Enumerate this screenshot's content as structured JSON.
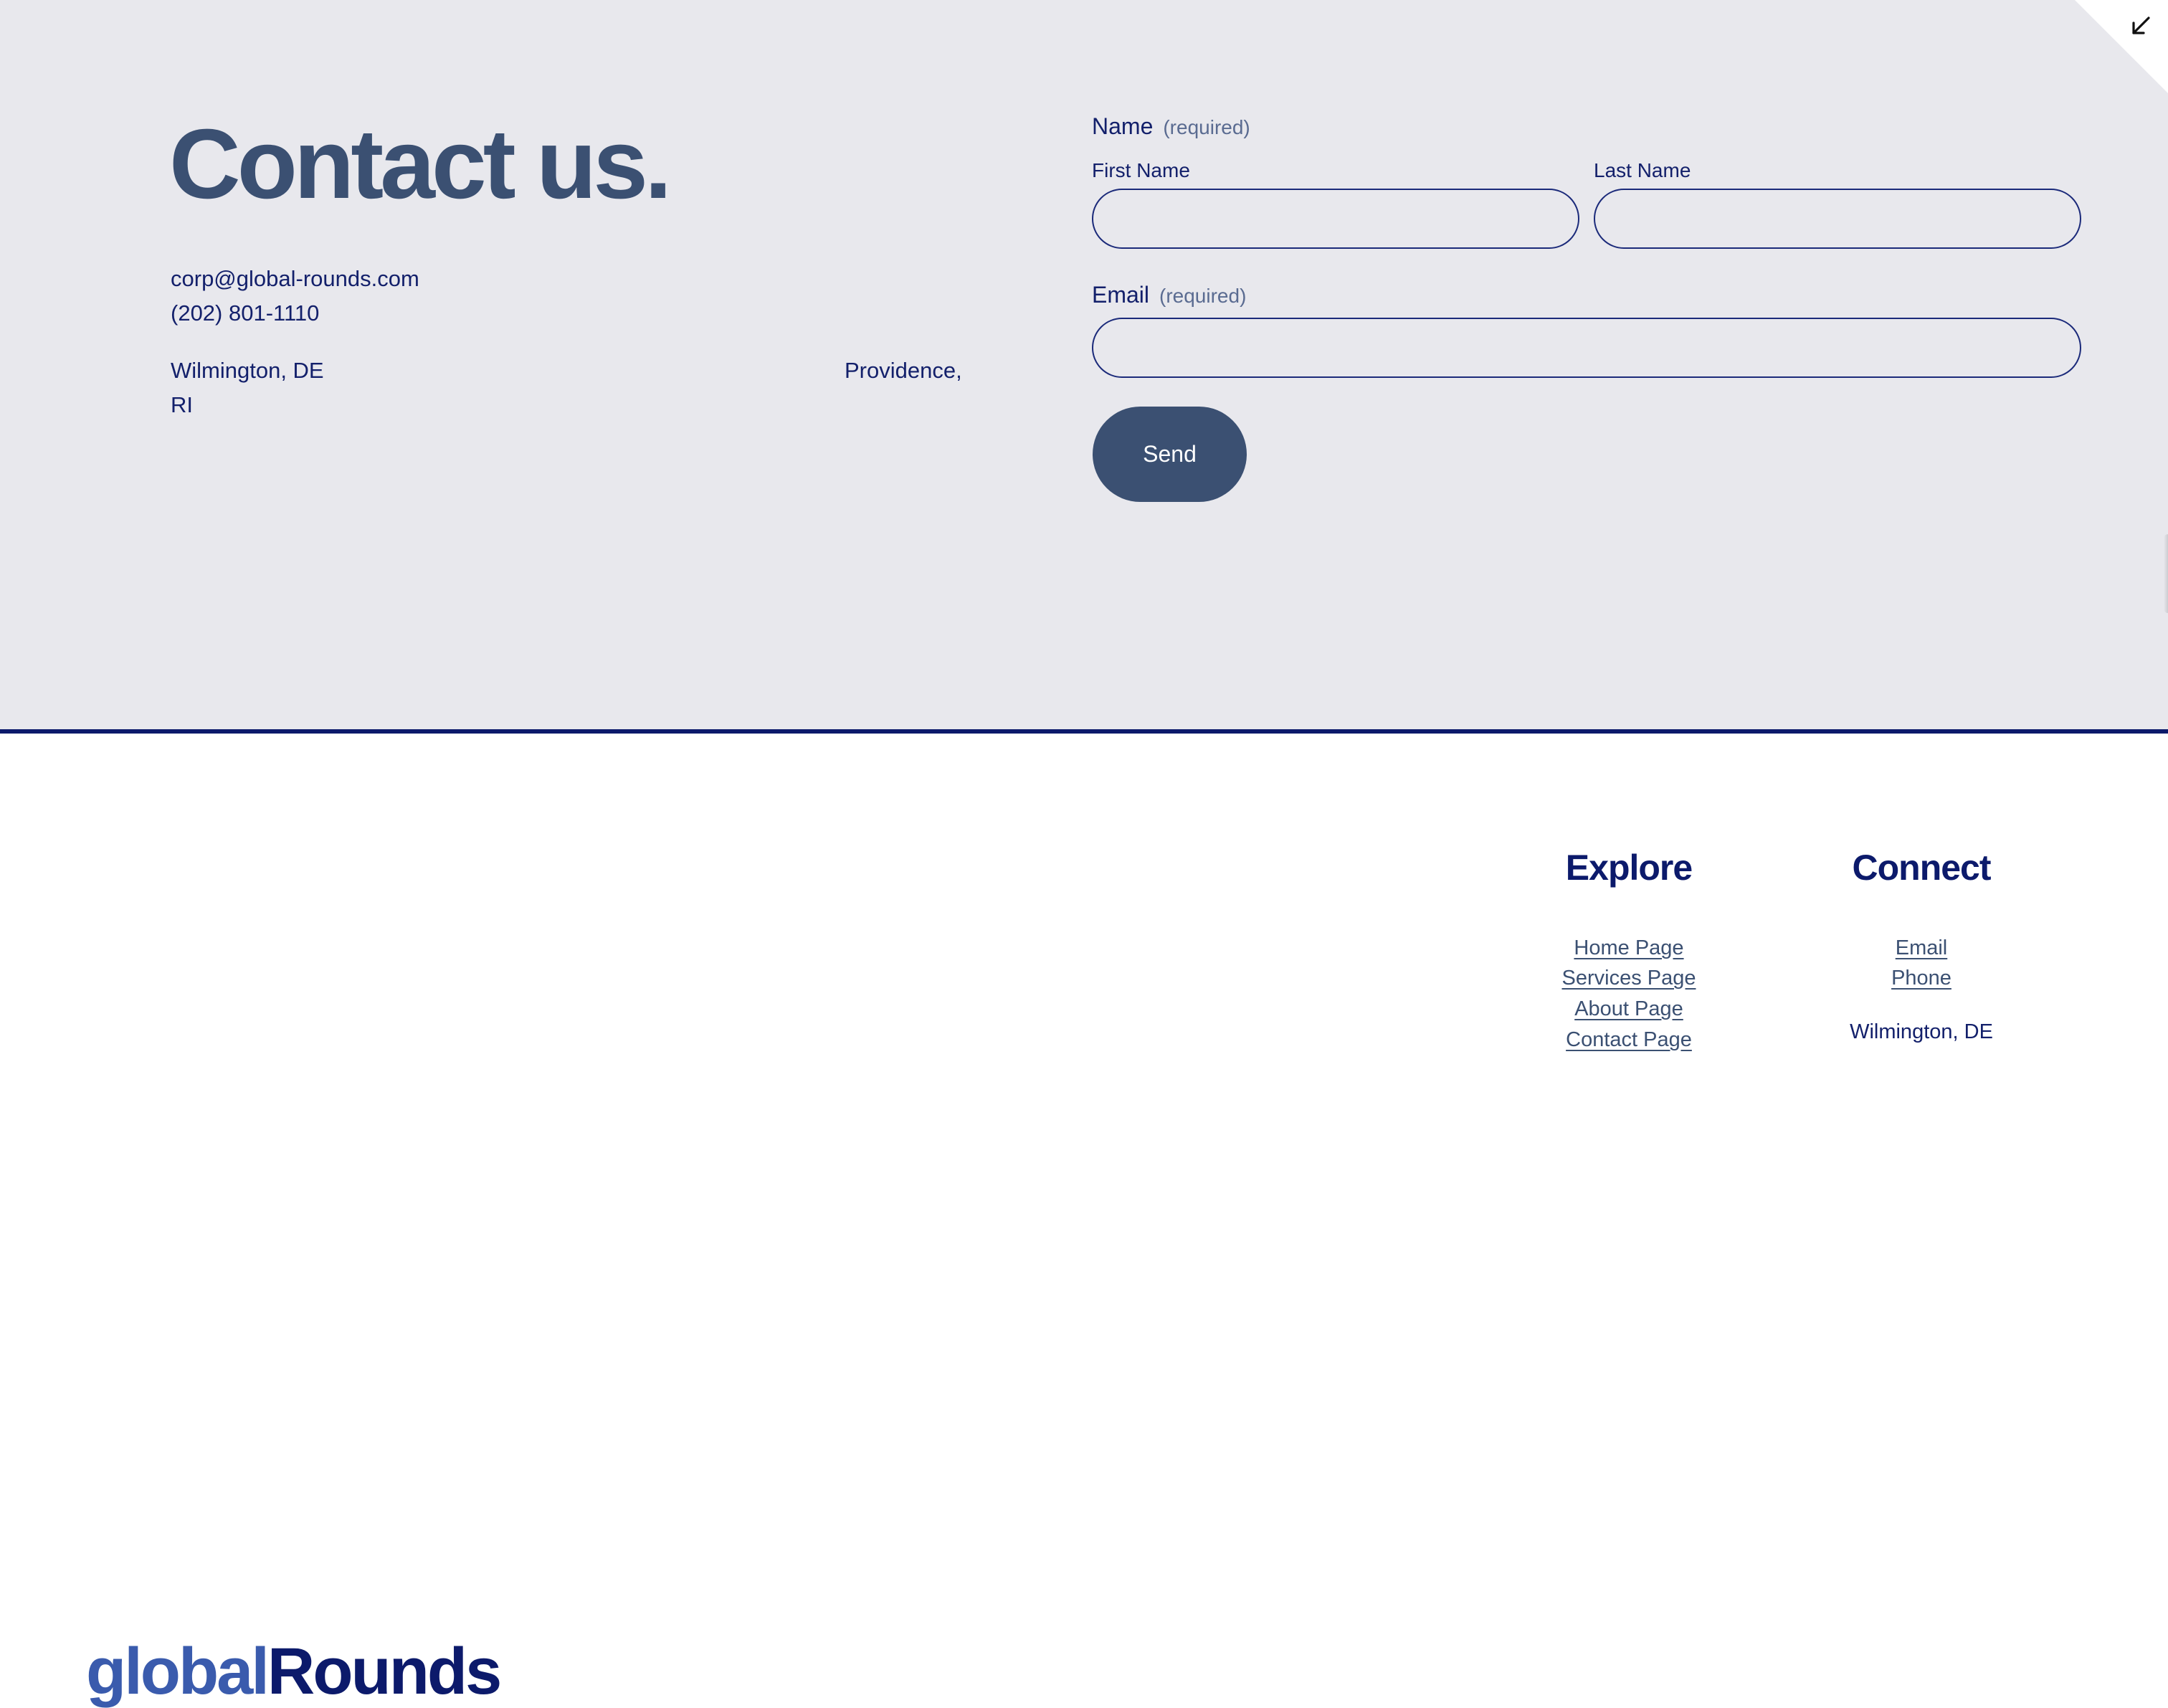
{
  "contact": {
    "title": "Contact us.",
    "email": "corp@global-rounds.com",
    "phone": "(202) 801-1110",
    "location_1": "Wilmington, DE",
    "location_2": "Providence,",
    "location_2_cont": "RI"
  },
  "form": {
    "name_label": "Name",
    "name_required": "(required)",
    "first_name_label": "First Name",
    "first_name_value": "",
    "last_name_label": "Last Name",
    "last_name_value": "",
    "email_label": "Email",
    "email_required": "(required)",
    "email_value": "",
    "send_label": "Send"
  },
  "footer": {
    "logo_part1": "global",
    "logo_part2": "Rounds",
    "explore": {
      "heading": "Explore",
      "links": [
        "Home Page",
        "Services Page",
        "About Page",
        "Contact Page"
      ]
    },
    "connect": {
      "heading": "Connect",
      "links": [
        "Email",
        "Phone"
      ],
      "location": "Wilmington, DE"
    }
  },
  "icons": {
    "corner": "arrow-down-left-icon"
  },
  "colors": {
    "section_bg": "#e8e8ed",
    "accent": "#3b5072",
    "navy": "#0c1a6b",
    "logo_blue": "#3a5bad"
  }
}
